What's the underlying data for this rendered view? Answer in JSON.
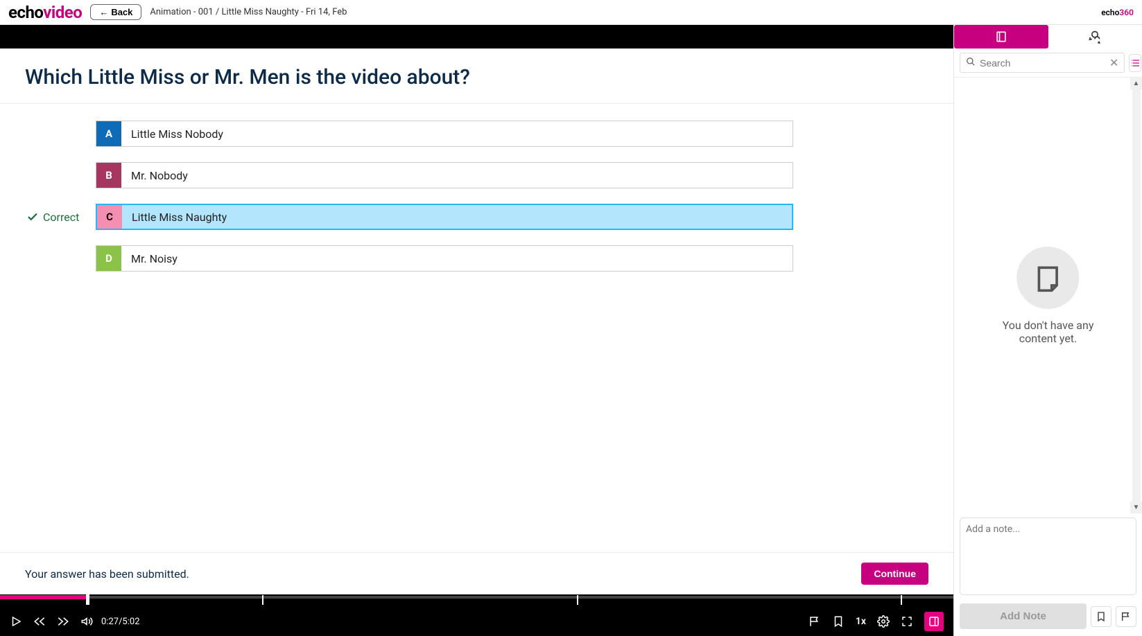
{
  "header": {
    "logo_part1": "echo",
    "logo_part2": "video",
    "back_label": "Back",
    "breadcrumb": "Animation - 001 / Little Miss Naughty - Fri 14, Feb",
    "right_logo_part1": "echo",
    "right_logo_part2": "360"
  },
  "question": {
    "title": "Which Little Miss or Mr. Men is the video about?",
    "correct_label": "Correct",
    "answers": [
      {
        "letter": "A",
        "text": "Little Miss Nobody",
        "letter_class": "letter-a",
        "is_correct": false
      },
      {
        "letter": "B",
        "text": "Mr. Nobody",
        "letter_class": "letter-b",
        "is_correct": false
      },
      {
        "letter": "C",
        "text": "Little Miss Naughty",
        "letter_class": "letter-c",
        "is_correct": true
      },
      {
        "letter": "D",
        "text": "Mr. Noisy",
        "letter_class": "letter-d",
        "is_correct": false
      }
    ],
    "submitted_msg": "Your answer has been submitted.",
    "continue_label": "Continue"
  },
  "player": {
    "time_display": "0:27/5:02",
    "speed_label": "1x",
    "progress_percent": 9,
    "markers_percent": [
      9,
      27.5,
      60.5,
      94.5
    ]
  },
  "sidebar": {
    "search_placeholder": "Search",
    "empty_message": "You don't have any content yet.",
    "note_placeholder": "Add a note...",
    "add_note_label": "Add Note"
  }
}
